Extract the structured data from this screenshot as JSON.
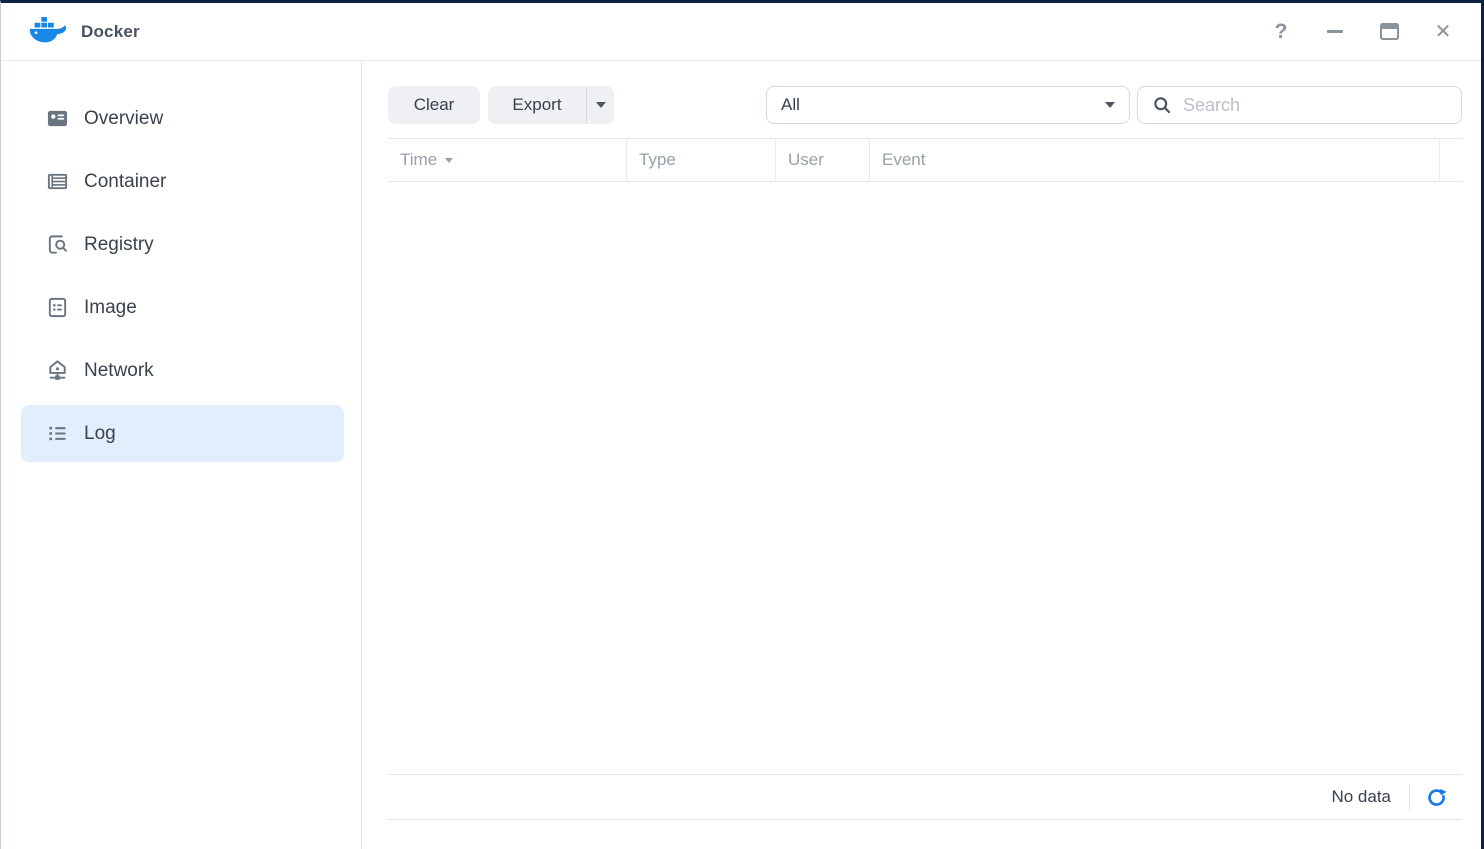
{
  "window": {
    "title": "Docker",
    "controls": {
      "help_label": "?",
      "close_label": "✕"
    }
  },
  "sidebar": {
    "items": [
      {
        "label": "Overview",
        "icon": "overview-icon",
        "selected": false
      },
      {
        "label": "Container",
        "icon": "container-icon",
        "selected": false
      },
      {
        "label": "Registry",
        "icon": "registry-icon",
        "selected": false
      },
      {
        "label": "Image",
        "icon": "image-icon",
        "selected": false
      },
      {
        "label": "Network",
        "icon": "network-icon",
        "selected": false
      },
      {
        "label": "Log",
        "icon": "log-icon",
        "selected": true
      }
    ]
  },
  "toolbar": {
    "clear_label": "Clear",
    "export_label": "Export",
    "filter_value": "All",
    "search": {
      "placeholder": "Search",
      "value": ""
    }
  },
  "table": {
    "columns": [
      "Time",
      "Type",
      "User",
      "Event"
    ],
    "sorted_column": "Time",
    "sort_direction": "desc",
    "rows": []
  },
  "footer": {
    "status": "No data"
  },
  "colors": {
    "accent_blue": "#1778e6",
    "docker_blue": "#1789e5",
    "selected_item_bg": "#e2eefb",
    "icon_gray": "#6b7581",
    "header_text": "#97a0aa",
    "window_border": "#0d2240"
  }
}
